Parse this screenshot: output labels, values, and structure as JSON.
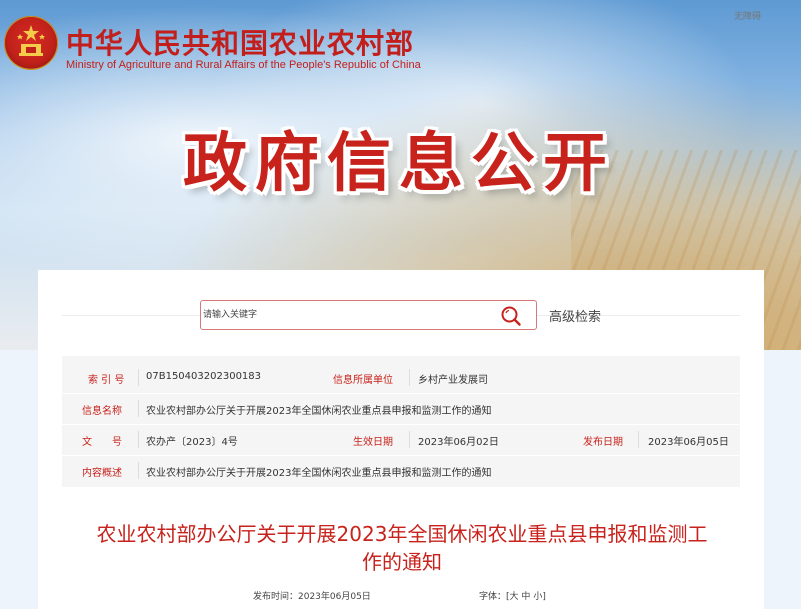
{
  "header": {
    "logo_cn": "中华人民共和国农业农村部",
    "logo_en": "Ministry of Agriculture and Rural Affairs of the People's Republic of China",
    "accessibility": "无障碍",
    "banner_title": "政府信息公开"
  },
  "search": {
    "placeholder": "请输入关键字",
    "advanced_label": "高级检索"
  },
  "info": {
    "index_label": "索 引 号",
    "index_value": "07B150403202300183",
    "unit_label": "信息所属单位",
    "unit_value": "乡村产业发展司",
    "name_label": "信息名称",
    "name_value": "农业农村部办公厅关于开展2023年全国休闲农业重点县申报和监测工作的通知",
    "doc_label": "文　　号",
    "doc_value": "农办产〔2023〕4号",
    "effective_label": "生效日期",
    "effective_value": "2023年06月02日",
    "publish_label": "发布日期",
    "publish_value": "2023年06月05日",
    "summary_label": "内容概述",
    "summary_value": "农业农村部办公厅关于开展2023年全国休闲农业重点县申报和监测工作的通知"
  },
  "article": {
    "title": "农业农村部办公厅关于开展2023年全国休闲农业重点县申报和监测工作的通知",
    "publish_time": "发布时间：2023年06月05日",
    "font_label": "字体：",
    "font_open": "[",
    "font_large": "大",
    "font_medium": "中",
    "font_small": "小",
    "font_close": "]"
  },
  "colors": {
    "accent_red": "#c7221c",
    "sky_blue": "#5e9ad3",
    "table_bg": "#f5f5f5"
  },
  "icons": [
    "national-emblem-icon",
    "search-icon"
  ]
}
